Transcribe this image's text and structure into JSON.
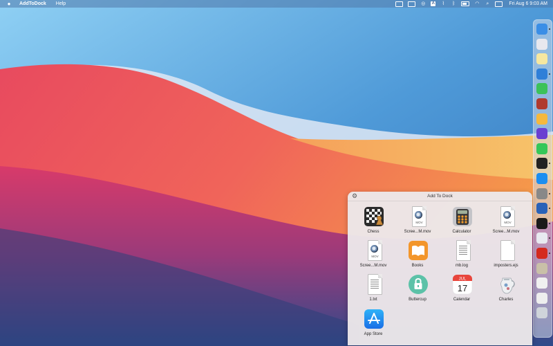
{
  "menubar": {
    "app_name": "AddToDock",
    "menu_items": [
      "Help"
    ],
    "status_icons": [
      "screen-icon",
      "display-icon",
      "focus-icon",
      "text-input-icon",
      "wifi-off-icon",
      "bluetooth-icon",
      "battery-icon",
      "wifi-icon",
      "search-icon",
      "control-center-icon"
    ],
    "clock": "Fri Aug 6  9:03 AM"
  },
  "popup": {
    "title": "Add To Dock",
    "items": [
      {
        "label": "Chess",
        "icon": "chess-icon"
      },
      {
        "label": "Scree...M.mov",
        "icon": "mov-file-icon",
        "file_tag": "MOV"
      },
      {
        "label": "Calculator",
        "icon": "calculator-icon"
      },
      {
        "label": "Scree...M.mov",
        "icon": "mov-file-icon",
        "file_tag": "MOV"
      },
      {
        "label": "Scree...M.mov",
        "icon": "mov-file-icon",
        "file_tag": "MOV"
      },
      {
        "label": "Books",
        "icon": "books-icon"
      },
      {
        "label": "mb.log",
        "icon": "log-file-icon"
      },
      {
        "label": "imposters.ejs",
        "icon": "ejs-file-icon"
      },
      {
        "label": "1.txt",
        "icon": "txt-file-icon"
      },
      {
        "label": "Buttercup",
        "icon": "buttercup-icon"
      },
      {
        "label": "Calendar",
        "icon": "calendar-icon",
        "cal_month": "JUL",
        "cal_day": "17"
      },
      {
        "label": "Charles",
        "icon": "charles-icon"
      },
      {
        "label": "App Store",
        "icon": "app-store-icon"
      }
    ]
  },
  "dock": {
    "items": [
      {
        "name": "finder-icon",
        "color": "#3a8ee6"
      },
      {
        "name": "launchpad-icon",
        "color": "#e8e8ee"
      },
      {
        "name": "notes-icon",
        "color": "#f6e7a0"
      },
      {
        "name": "xcode-icon",
        "color": "#2f7fd8"
      },
      {
        "name": "facetime-icon",
        "color": "#3cc25a"
      },
      {
        "name": "dictionary-icon",
        "color": "#b03a2e"
      },
      {
        "name": "home-icon",
        "color": "#f5b83d"
      },
      {
        "name": "imovie-icon",
        "color": "#6a3fd1"
      },
      {
        "name": "messages-icon",
        "color": "#35c759"
      },
      {
        "name": "terminal-icon",
        "color": "#222222"
      },
      {
        "name": "app-store-icon",
        "color": "#1c8ef0"
      },
      {
        "name": "system-preferences-icon",
        "color": "#888888"
      },
      {
        "name": "screenshot-icon",
        "color": "#2a62b8"
      },
      {
        "name": "activity-monitor-icon",
        "color": "#1a1a1a"
      },
      {
        "name": "mail-icon",
        "color": "#e8eaf0"
      },
      {
        "name": "acrobat-icon",
        "color": "#d42a1e"
      },
      {
        "name": "archive-icon",
        "color": "#c9c0a8"
      },
      {
        "name": "window-icon",
        "color": "#f0f0f0"
      },
      {
        "name": "preview-icon",
        "color": "#eeeeee"
      },
      {
        "name": "trash-icon",
        "color": "#cfd4da"
      }
    ],
    "running_indicators": [
      "finder-icon",
      "xcode-icon",
      "terminal-icon",
      "system-preferences-icon",
      "screenshot-icon",
      "activity-monitor-icon",
      "mail-icon",
      "acrobat-icon"
    ]
  }
}
